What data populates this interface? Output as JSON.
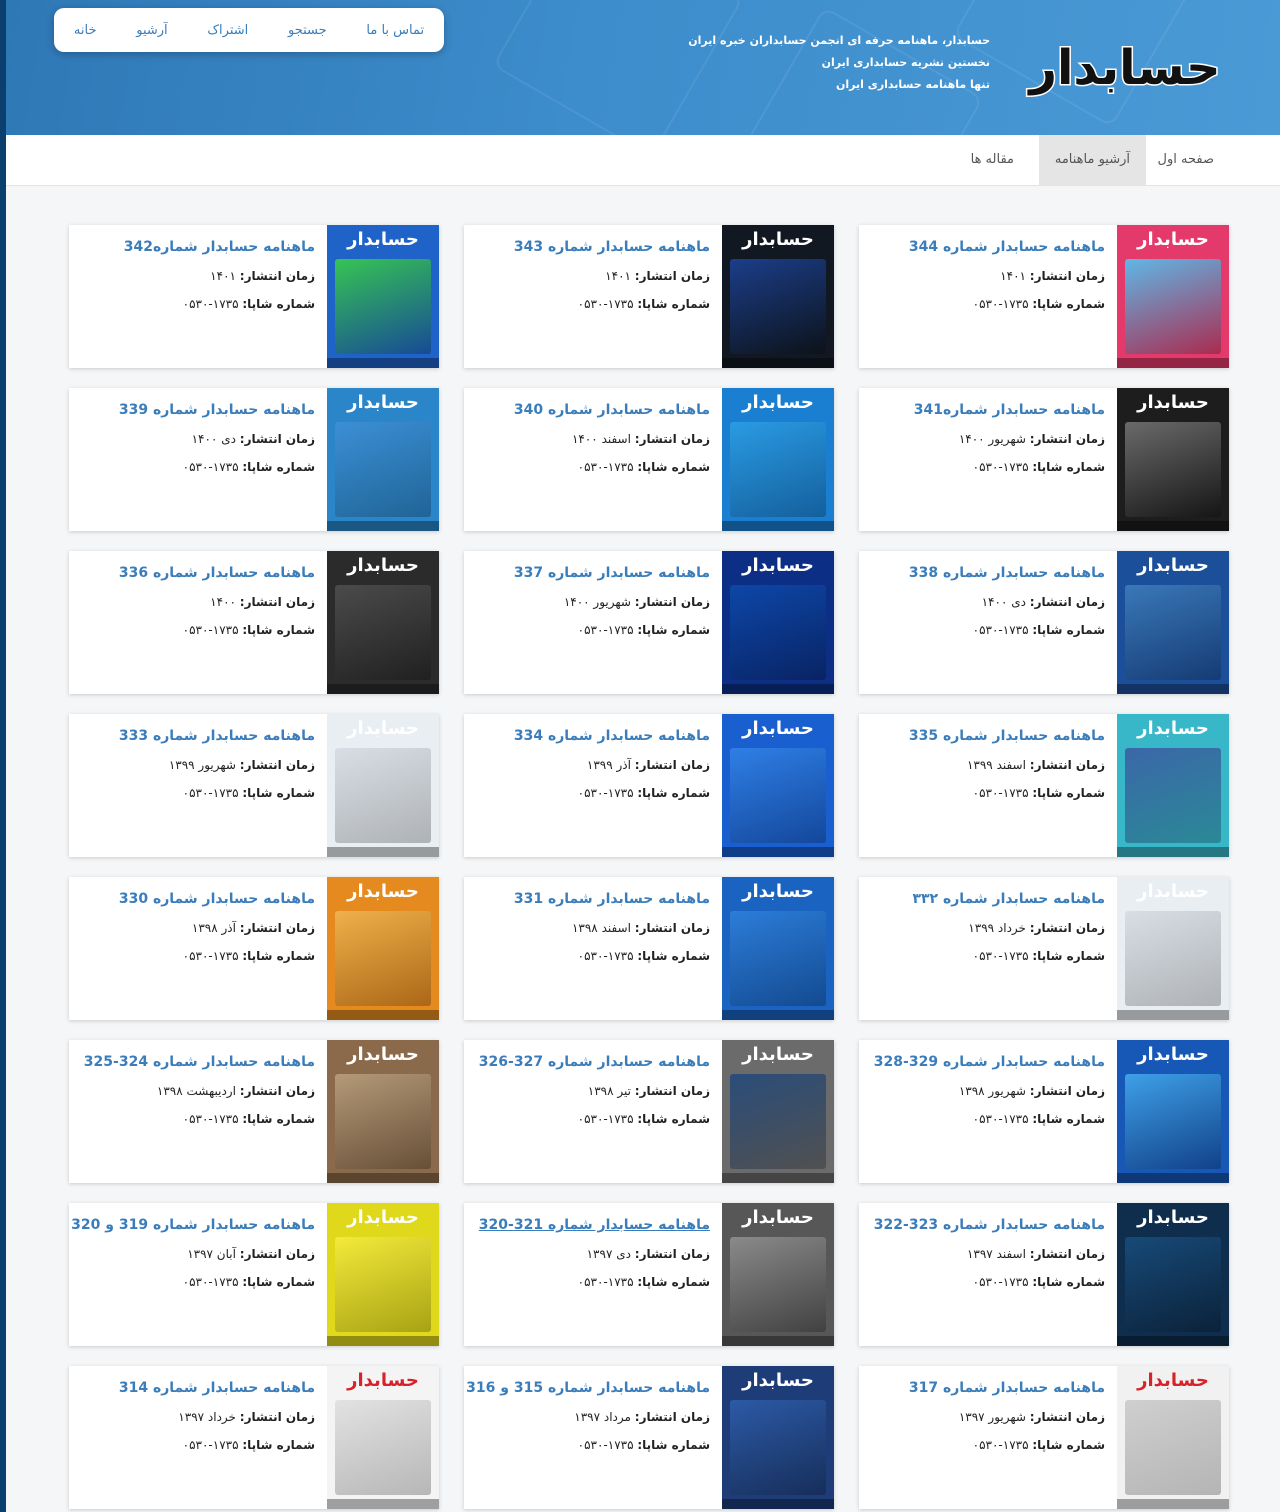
{
  "header": {
    "logo_text": "حسابدار",
    "taglines": [
      "حسابدار، ماهنامه حرفه ای انجمن حسابداران خبره ایران",
      "نخستین نشریه حسابداری ایران",
      "تنها ماهنامه حسابداری ایران"
    ],
    "topnav": [
      "خانه",
      "آرشیو",
      "اشتراک",
      "جستجو",
      "تماس با ما"
    ]
  },
  "tabs": {
    "home": "صفحه اول",
    "archive": "آرشیو ماهنامه",
    "articles": "مقاله ها"
  },
  "labels": {
    "date_label": "زمان انتشار:",
    "issn_label": "شماره شاپا:",
    "issn": "۱۷۳۵-۰۵۳۰"
  },
  "issues": [
    {
      "title": "ماهنامه حسابدار شماره 344",
      "date": "۱۴۰۱",
      "cover": "#e33a6b",
      "art": "#5fb7e6"
    },
    {
      "title": "ماهنامه حسابدار شماره 343",
      "date": "۱۴۰۱",
      "cover": "#111822",
      "art": "#1b3e8a"
    },
    {
      "title": "ماهنامه حسابدار شماره342",
      "date": "۱۴۰۱",
      "cover": "#1f63c9",
      "art": "#36c453"
    },
    {
      "title": "ماهنامه حسابدار شماره341",
      "date": "شهریور ۱۴۰۰",
      "cover": "#1d1d1d",
      "art": "#6a6a6a"
    },
    {
      "title": "ماهنامه حسابدار شماره 340",
      "date": "اسفند ۱۴۰۰",
      "cover": "#1b7fd1",
      "art": "#2a9be3"
    },
    {
      "title": "ماهنامه حسابدار شماره 339",
      "date": "دی ۱۴۰۰",
      "cover": "#2a86c9",
      "art": "#3c8fd6"
    },
    {
      "title": "ماهنامه حسابدار شماره 338",
      "date": "دی ۱۴۰۰",
      "cover": "#1c4f9a",
      "art": "#3a78b9"
    },
    {
      "title": "ماهنامه حسابدار شماره 337",
      "date": "شهریور ۱۴۰۰",
      "cover": "#0c2f85",
      "art": "#0d47a8"
    },
    {
      "title": "ماهنامه حسابدار شماره 336",
      "date": "۱۴۰۰",
      "cover": "#2b2b2b",
      "art": "#4b4b4b"
    },
    {
      "title": "ماهنامه حسابدار شماره 335",
      "date": "اسفند ۱۳۹۹",
      "cover": "#38b7c9",
      "art": "#3b67a8"
    },
    {
      "title": "ماهنامه حسابدار شماره 334",
      "date": "آذر ۱۳۹۹",
      "cover": "#1a5fcf",
      "art": "#2f7fe6"
    },
    {
      "title": "ماهنامه حسابدار شماره 333",
      "date": "شهریور ۱۳۹۹",
      "cover": "#e9eef3",
      "art": "#d9dee4"
    },
    {
      "title": "ماهنامه حسابدار شماره ۳۳۲",
      "date": "خرداد ۱۳۹۹",
      "cover": "#e9eef3",
      "art": "#d9dee4"
    },
    {
      "title": "ماهنامه حسابدار شماره 331",
      "date": "اسفند ۱۳۹۸",
      "cover": "#1a63c1",
      "art": "#2c7dd9"
    },
    {
      "title": "ماهنامه حسابدار شماره 330",
      "date": "آذر ۱۳۹۸",
      "cover": "#e58a1f",
      "art": "#f0b04a"
    },
    {
      "title": "ماهنامه حسابدار شماره 329-328",
      "date": "شهریور ۱۳۹۸",
      "cover": "#1757b6",
      "art": "#3ea0e8"
    },
    {
      "title": "ماهنامه حسابدار شماره 327-326",
      "date": "تیر ۱۳۹۸",
      "cover": "#6b6b6b",
      "art": "#2a4d7a"
    },
    {
      "title": "ماهنامه حسابدار شماره 324-325",
      "date": "اردیبهشت ۱۳۹۸",
      "cover": "#8a6a4a",
      "art": "#b49a78"
    },
    {
      "title": "ماهنامه حسابدار شماره 323-322",
      "date": "اسفند ۱۳۹۷",
      "cover": "#0f2d4d",
      "art": "#174a78"
    },
    {
      "title": "ماهنامه حسابدار شماره 321-320",
      "date": "دی ۱۳۹۷",
      "cover": "#575757",
      "art": "#8a8a8a",
      "underline": true
    },
    {
      "title": "ماهنامه حسابدار شماره 319 و 320",
      "date": "آبان ۱۳۹۷",
      "cover": "#e0d91b",
      "art": "#f3ea3a"
    },
    {
      "title": "ماهنامه حسابدار شماره 317",
      "date": "شهریور ۱۳۹۷",
      "cover": "#f1f1f1",
      "art": "#cfcfcf",
      "redlogo": true
    },
    {
      "title": "ماهنامه حسابدار شماره 315 و 316",
      "date": "مرداد ۱۳۹۷",
      "cover": "#1e3d78",
      "art": "#2c5aa6"
    },
    {
      "title": "ماهنامه حسابدار شماره 314",
      "date": "خرداد ۱۳۹۷",
      "cover": "#f4f4f4",
      "art": "#e2e2e2",
      "redlogo": true
    }
  ]
}
